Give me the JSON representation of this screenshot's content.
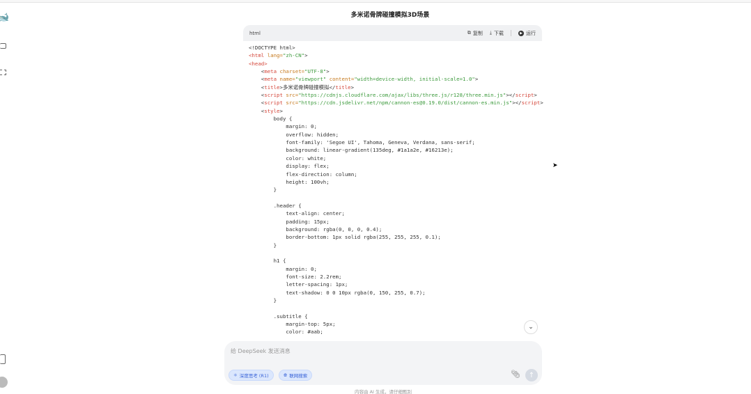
{
  "conversation_title": "多米诺骨牌碰撞模拟3D场景",
  "code_block": {
    "language": "html",
    "copy_label": "复制",
    "download_label": "下载",
    "run_label": "运行",
    "lines": [
      [
        [
          "<!DOCTYPE html>",
          ""
        ]
      ],
      [
        [
          "<html ",
          "tag"
        ],
        [
          "lang=",
          "attr"
        ],
        [
          "\"zh-CN\"",
          "str"
        ],
        [
          ">",
          ""
        ]
      ],
      [
        [
          "<head>",
          "tag"
        ]
      ],
      [
        [
          "    <",
          ""
        ],
        [
          "meta ",
          "tag"
        ],
        [
          "charset=",
          "attr"
        ],
        [
          "\"UTF-8\"",
          "str"
        ],
        [
          ">",
          ""
        ]
      ],
      [
        [
          "    <",
          ""
        ],
        [
          "meta ",
          "tag"
        ],
        [
          "name=",
          "attr"
        ],
        [
          "\"viewport\" ",
          "str"
        ],
        [
          "content=",
          "attr"
        ],
        [
          "\"width=device-width, initial-scale=1.0\"",
          "str"
        ],
        [
          ">",
          ""
        ]
      ],
      [
        [
          "    <",
          ""
        ],
        [
          "title",
          "tag"
        ],
        [
          ">多米诺骨牌碰撞模拟</",
          ""
        ],
        [
          "title",
          "tag"
        ],
        [
          ">",
          ""
        ]
      ],
      [
        [
          "    <",
          ""
        ],
        [
          "script ",
          "tag"
        ],
        [
          "src=",
          "attr"
        ],
        [
          "\"https://cdnjs.cloudflare.com/ajax/libs/three.js/r128/three.min.js\"",
          "str"
        ],
        [
          "></",
          ""
        ],
        [
          "script",
          "tag"
        ],
        [
          ">",
          ""
        ]
      ],
      [
        [
          "    <",
          ""
        ],
        [
          "script ",
          "tag"
        ],
        [
          "src=",
          "attr"
        ],
        [
          "\"https://cdn.jsdelivr.net/npm/cannon-es@0.19.0/dist/cannon-es.min.js\"",
          "str"
        ],
        [
          "></",
          ""
        ],
        [
          "script",
          "tag"
        ],
        [
          ">",
          ""
        ]
      ],
      [
        [
          "    <",
          ""
        ],
        [
          "style",
          "tag"
        ],
        [
          ">",
          ""
        ]
      ],
      [
        [
          "        body {",
          ""
        ]
      ],
      [
        [
          "            margin: 0;",
          ""
        ]
      ],
      [
        [
          "            overflow: hidden;",
          ""
        ]
      ],
      [
        [
          "            font-family: 'Segoe UI', Tahoma, Geneva, Verdana, sans-serif;",
          ""
        ]
      ],
      [
        [
          "            background: linear-gradient(135deg, #1a1a2e, #16213e);",
          ""
        ]
      ],
      [
        [
          "            color: white;",
          ""
        ]
      ],
      [
        [
          "            display: flex;",
          ""
        ]
      ],
      [
        [
          "            flex-direction: column;",
          ""
        ]
      ],
      [
        [
          "            height: 100vh;",
          ""
        ]
      ],
      [
        [
          "        }",
          ""
        ]
      ],
      [
        [
          "",
          ""
        ]
      ],
      [
        [
          "        .header {",
          ""
        ]
      ],
      [
        [
          "            text-align: center;",
          ""
        ]
      ],
      [
        [
          "            padding: 15px;",
          ""
        ]
      ],
      [
        [
          "            background: rgba(0, 0, 0, 0.4);",
          ""
        ]
      ],
      [
        [
          "            border-bottom: 1px solid rgba(255, 255, 255, 0.1);",
          ""
        ]
      ],
      [
        [
          "        }",
          ""
        ]
      ],
      [
        [
          "",
          ""
        ]
      ],
      [
        [
          "        h1 {",
          ""
        ]
      ],
      [
        [
          "            margin: 0;",
          ""
        ]
      ],
      [
        [
          "            font-size: 2.2rem;",
          ""
        ]
      ],
      [
        [
          "            letter-spacing: 1px;",
          ""
        ]
      ],
      [
        [
          "            text-shadow: 0 0 10px rgba(0, 150, 255, 0.7);",
          ""
        ]
      ],
      [
        [
          "        }",
          ""
        ]
      ],
      [
        [
          "",
          ""
        ]
      ],
      [
        [
          "        .subtitle {",
          ""
        ]
      ],
      [
        [
          "            margin-top: 5px;",
          ""
        ]
      ],
      [
        [
          "            color: #aab;",
          ""
        ]
      ]
    ]
  },
  "composer": {
    "placeholder": "给 DeepSeek 发送消息",
    "deep_think_label": "深度思考 (R1)",
    "web_search_label": "联网搜索"
  },
  "footer_note": "内容由 AI 生成，请仔细甄别",
  "colors": {
    "brand": "#4d6bfe",
    "chip_bg": "#dbe7fd"
  }
}
